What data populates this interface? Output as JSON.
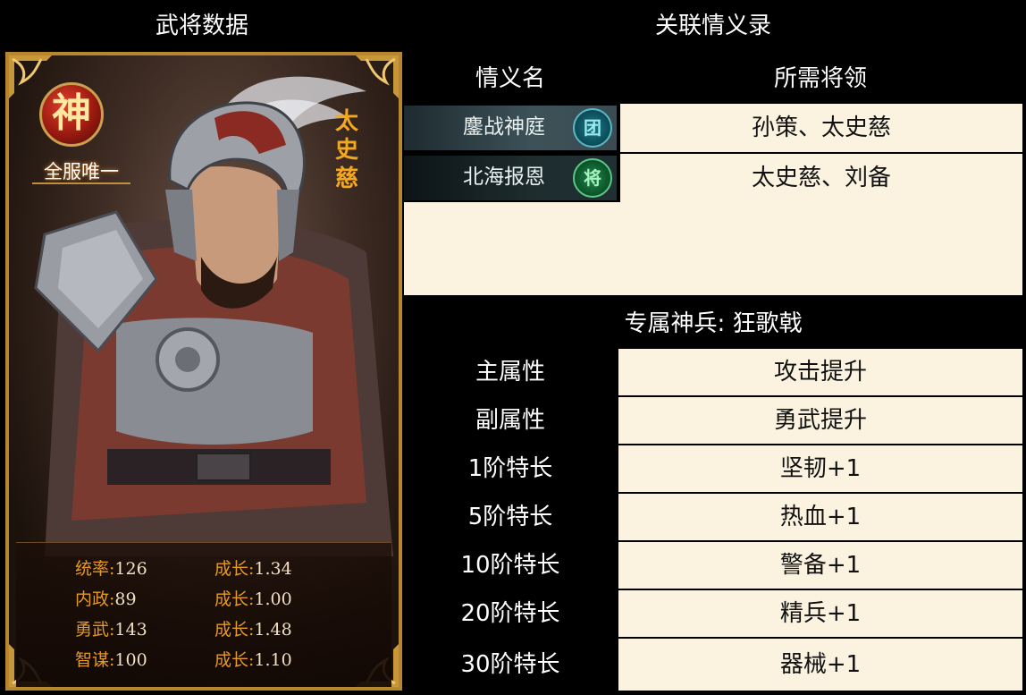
{
  "left_panel": {
    "header": "武将数据",
    "card": {
      "rank_badge": "神",
      "unique_label": "全服唯一",
      "name_chars": [
        "太",
        "史",
        "慈"
      ],
      "stats": [
        {
          "label": "统率:",
          "value": "126",
          "growth_label": "成长:",
          "growth": "1.34"
        },
        {
          "label": "内政:",
          "value": "89",
          "growth_label": "成长:",
          "growth": "1.00"
        },
        {
          "label": "勇武:",
          "value": "143",
          "growth_label": "成长:",
          "growth": "1.48"
        },
        {
          "label": "智谋:",
          "value": "100",
          "growth_label": "成长:",
          "growth": "1.10"
        }
      ]
    }
  },
  "bonds": {
    "header": "关联情义录",
    "col_name": "情义名",
    "col_required": "所需将领",
    "rows": [
      {
        "name": "鏖战神庭",
        "icon": "团",
        "icon_name": "tuan-icon",
        "required": "孙策、太史慈"
      },
      {
        "name": "北海报恩",
        "icon": "将",
        "icon_name": "jiang-icon",
        "required": "太史慈、刘备"
      }
    ]
  },
  "weapon": {
    "header": "专属神兵: 狂歌戟",
    "rows": [
      {
        "label": "主属性",
        "value": "攻击提升"
      },
      {
        "label": "副属性",
        "value": "勇武提升"
      },
      {
        "label": "1阶特长",
        "value": "坚韧+1"
      },
      {
        "label": "5阶特长",
        "value": "热血+1"
      },
      {
        "label": "10阶特长",
        "value": "警备+1"
      },
      {
        "label": "20阶特长",
        "value": "精兵+1"
      },
      {
        "label": "30阶特长",
        "value": "器械+1"
      }
    ]
  },
  "colors": {
    "frame_gold": "#b8862e",
    "stat_label_orange": "#e69a20",
    "name_orange": "#f4a820",
    "cream": "#fbf3e0"
  }
}
